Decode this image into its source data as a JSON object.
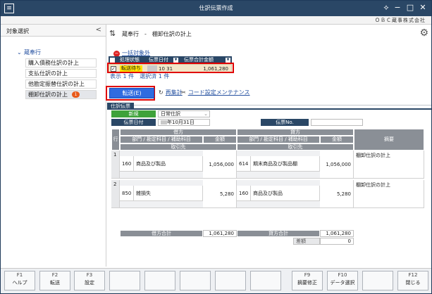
{
  "window": {
    "title": "仕訳伝票作成"
  },
  "company": {
    "name": "ＯＢＣ蔵事株式会社"
  },
  "sidebar": {
    "header": "対象選択",
    "collapse_glyph": "<",
    "root": "蔵奉行",
    "items": [
      {
        "label": "購入債務仕訳の計上"
      },
      {
        "label": "支払仕訳の計上"
      },
      {
        "label": "他勘定振替仕訳の計上"
      },
      {
        "label": "棚卸仕訳の計上",
        "badge": "1",
        "selected": true
      }
    ]
  },
  "module_header": {
    "title": "蔵奉行　-　棚卸仕訳の計上"
  },
  "exclude_link": "一括対象外",
  "slip_list": {
    "headers": [
      "処理状態",
      "伝票日付",
      "伝票合計金額"
    ],
    "rows": [
      {
        "checked": true,
        "status": "転送待ち",
        "date": "10 31",
        "amount": "1,061,280"
      }
    ],
    "count_text": "表示 1 件　選択済 1 件"
  },
  "buttons": {
    "transfer": "転送(E)",
    "recalc": "再集計",
    "code_settings": "コード設定メンテナンス"
  },
  "slip": {
    "tab": "仕訳伝票",
    "type_label": "新規",
    "type_value": "日常仕訳",
    "date_label": "伝票日付",
    "date_value": "年10月31日",
    "no_label": "伝票No.",
    "headers": {
      "row": "行",
      "debit": "借方",
      "credit": "貸方",
      "dept_account": "部門 / 勘定科目 / 補助科目",
      "amount": "金額",
      "partner": "取引先",
      "memo": "摘要"
    },
    "lines": [
      {
        "no": "1",
        "debit_dept": "160",
        "debit_account": "商品及び製品",
        "debit_amount": "1,056,000",
        "credit_dept": "614",
        "credit_account": "期末商品及び製品棚",
        "credit_amount": "1,056,000",
        "memo": "棚卸仕訳の計上"
      },
      {
        "no": "2",
        "debit_dept": "850",
        "debit_account": "雑損失",
        "debit_amount": "5,280",
        "credit_dept": "160",
        "credit_account": "商品及び製品",
        "credit_amount": "5,280",
        "memo": "棚卸仕訳の計上"
      }
    ],
    "totals": {
      "debit_label": "借方合計",
      "debit_total": "1,061,280",
      "credit_label": "貸方合計",
      "credit_total": "1,061,280",
      "diff_label": "差額",
      "diff_value": "0"
    }
  },
  "fkeys": [
    {
      "key": "F1",
      "label": "ヘルプ"
    },
    {
      "key": "F2",
      "label": "転送"
    },
    {
      "key": "F3",
      "label": "設定"
    },
    {
      "key": "",
      "label": ""
    },
    {
      "key": "",
      "label": ""
    },
    {
      "key": "",
      "label": ""
    },
    {
      "key": "",
      "label": ""
    },
    {
      "key": "",
      "label": ""
    },
    {
      "key": "F9",
      "label": "摘要修正"
    },
    {
      "key": "F10",
      "label": "データ選択"
    },
    {
      "key": "",
      "label": ""
    },
    {
      "key": "F12",
      "label": "閉じる"
    }
  ],
  "colors": {
    "titlebar": "#2a4766",
    "accent_button": "#2f6be0",
    "highlight": "#e00000",
    "status": "#ffe400",
    "new_label": "#3ea23a"
  }
}
